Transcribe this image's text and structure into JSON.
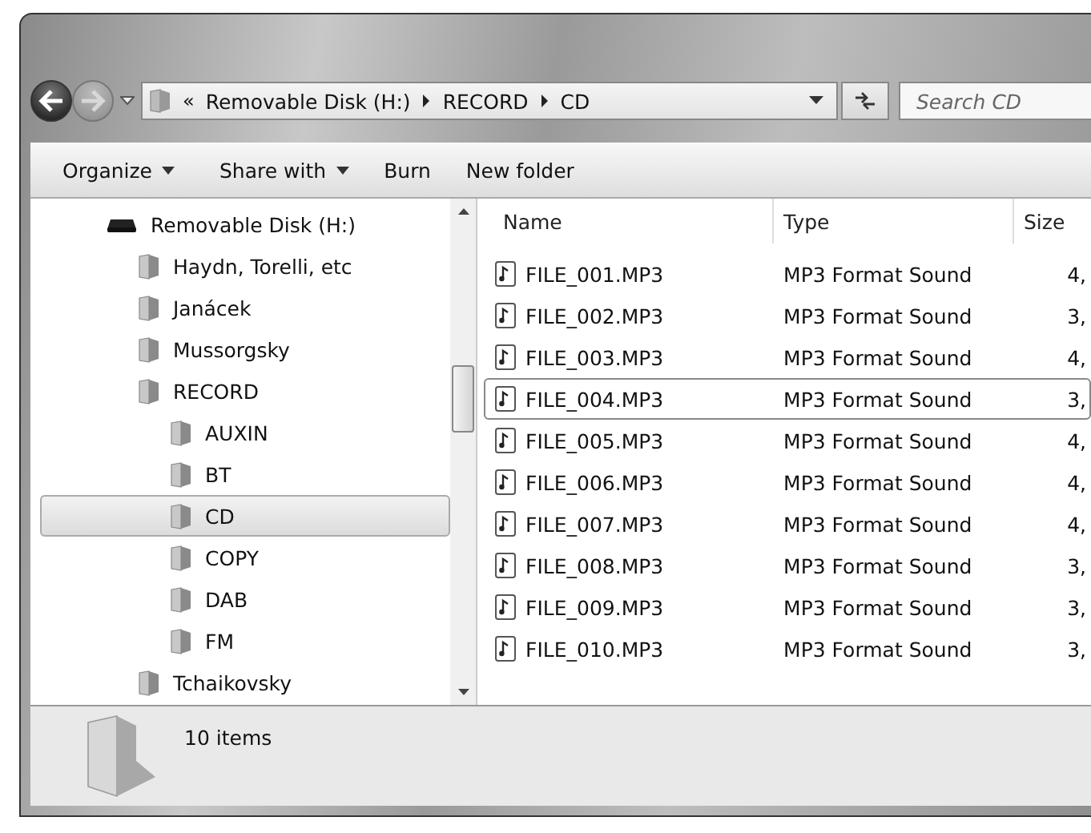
{
  "address_bar": {
    "overflow": "«",
    "crumbs": [
      "Removable Disk (H:)",
      "RECORD",
      "CD"
    ]
  },
  "search": {
    "placeholder": "Search CD"
  },
  "toolbar": [
    {
      "label": "Organize",
      "dropdown": true
    },
    {
      "label": "Share with",
      "dropdown": true
    },
    {
      "label": "Burn",
      "dropdown": false
    },
    {
      "label": "New folder",
      "dropdown": false
    }
  ],
  "sidebar": {
    "items": [
      {
        "label": "Removable Disk (H:)",
        "kind": "drive",
        "selected": false,
        "children": [
          {
            "label": "Haydn, Torelli, etc",
            "kind": "folder",
            "selected": false
          },
          {
            "label": "Janácek",
            "kind": "folder",
            "selected": false
          },
          {
            "label": "Mussorgsky",
            "kind": "folder",
            "selected": false
          },
          {
            "label": "RECORD",
            "kind": "folder",
            "selected": false,
            "children": [
              {
                "label": "AUXIN",
                "kind": "folder",
                "selected": false
              },
              {
                "label": "BT",
                "kind": "folder",
                "selected": false
              },
              {
                "label": "CD",
                "kind": "folder",
                "selected": true
              },
              {
                "label": "COPY",
                "kind": "folder",
                "selected": false
              },
              {
                "label": "DAB",
                "kind": "folder",
                "selected": false
              },
              {
                "label": "FM",
                "kind": "folder",
                "selected": false
              }
            ]
          },
          {
            "label": "Tchaikovsky",
            "kind": "folder",
            "selected": false
          }
        ]
      }
    ]
  },
  "table": {
    "columns": [
      "Name",
      "Type",
      "Size"
    ],
    "rows": [
      {
        "name": "FILE_001.MP3",
        "type": "MP3 Format Sound",
        "size": "4,",
        "focused": false
      },
      {
        "name": "FILE_002.MP3",
        "type": "MP3 Format Sound",
        "size": "3,",
        "focused": false
      },
      {
        "name": "FILE_003.MP3",
        "type": "MP3 Format Sound",
        "size": "4,",
        "focused": false
      },
      {
        "name": "FILE_004.MP3",
        "type": "MP3 Format Sound",
        "size": "3,",
        "focused": true
      },
      {
        "name": "FILE_005.MP3",
        "type": "MP3 Format Sound",
        "size": "4,",
        "focused": false
      },
      {
        "name": "FILE_006.MP3",
        "type": "MP3 Format Sound",
        "size": "4,",
        "focused": false
      },
      {
        "name": "FILE_007.MP3",
        "type": "MP3 Format Sound",
        "size": "4,",
        "focused": false
      },
      {
        "name": "FILE_008.MP3",
        "type": "MP3 Format Sound",
        "size": "3,",
        "focused": false
      },
      {
        "name": "FILE_009.MP3",
        "type": "MP3 Format Sound",
        "size": "3,",
        "focused": false
      },
      {
        "name": "FILE_010.MP3",
        "type": "MP3 Format Sound",
        "size": "3,",
        "focused": false
      }
    ]
  },
  "status_bar": {
    "text": "10 items"
  }
}
